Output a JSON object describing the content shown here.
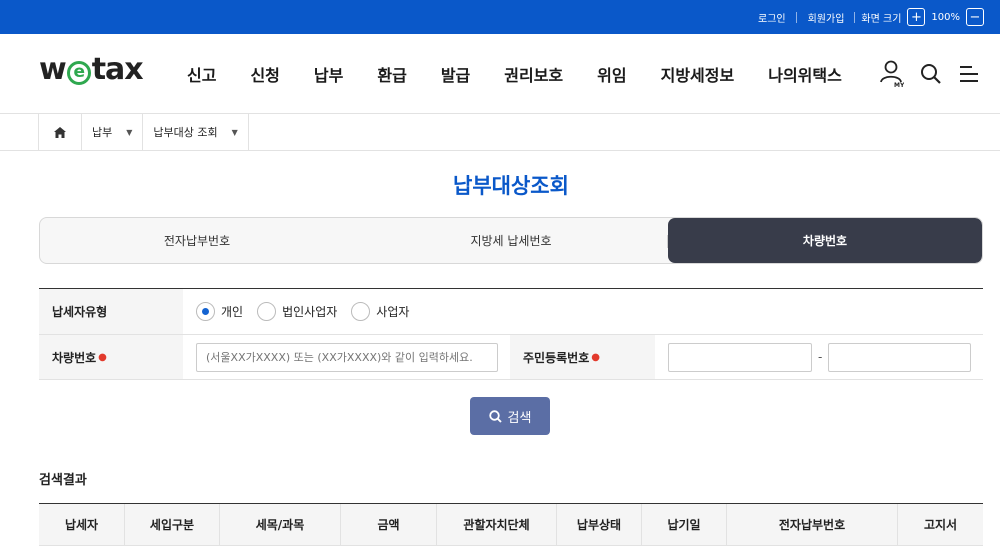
{
  "topbar": {
    "login": "로그인",
    "join": "회원가입",
    "zoom_label": "화면 크기",
    "zoom_in": "+",
    "zoom_value": "100%",
    "zoom_out": "−"
  },
  "logo": {
    "pre": "w",
    "mid": "e",
    "post": "tax"
  },
  "gnb": [
    "신고",
    "신청",
    "납부",
    "환급",
    "발급",
    "권리보호",
    "위임",
    "지방세정보",
    "나의위택스"
  ],
  "breadcrumb": {
    "level1": "납부",
    "level2": "납부대상 조회"
  },
  "page_title": "납부대상조회",
  "tabs": [
    "전자납부번호",
    "지방세 납세번호",
    "차량번호"
  ],
  "form": {
    "taxpayer_type_label": "납세자유형",
    "options": [
      "개인",
      "법인사업자",
      "사업자"
    ],
    "vehicle_label": "차량번호",
    "vehicle_placeholder": "(서울XX가XXXX) 또는 (XX가XXXX)와 같이 입력하세요.",
    "rrn_label": "주민등록번호",
    "rrn_dash": "-"
  },
  "search_button": "검색",
  "results_title": "검색결과",
  "columns": [
    "납세자",
    "세입구분",
    "세목/과목",
    "금액",
    "관할자치단체",
    "납부상태",
    "납기일",
    "전자납부번호",
    "고지서"
  ],
  "colors": {
    "accent": "#0a58c9",
    "active_tab": "#383c4a",
    "search_btn": "#5b6ea5",
    "required": "#e23a2c",
    "logo_e": "#2fa84f"
  }
}
